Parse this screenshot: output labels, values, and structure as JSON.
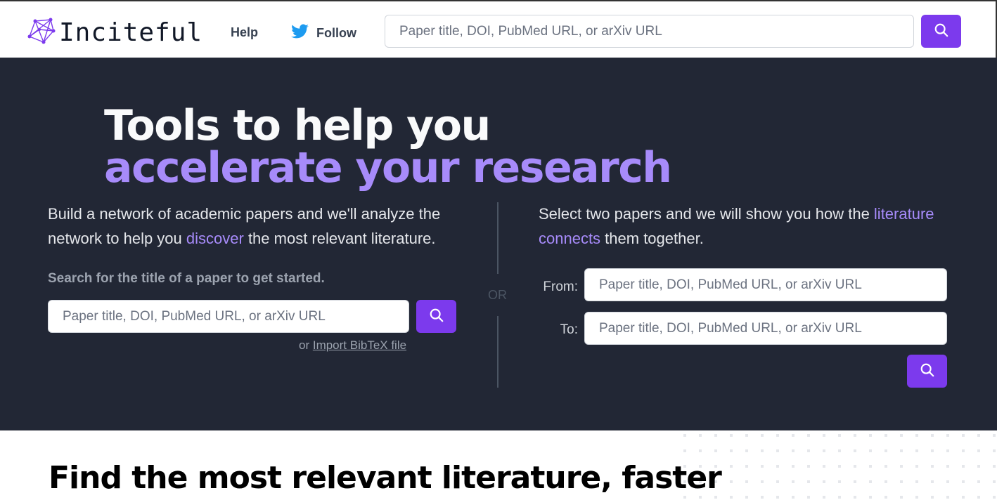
{
  "brand": {
    "name": "Inciteful"
  },
  "nav": {
    "help": "Help",
    "follow": "Follow",
    "search_placeholder": "Paper title, DOI, PubMed URL, or arXiv URL"
  },
  "hero": {
    "title_line1": "Tools to help you",
    "title_line2": "accelerate your research",
    "left": {
      "lead_part1": "Build a network of academic papers and we'll analyze the network to help you ",
      "lead_accent": "discover",
      "lead_part2": " the most relevant literature.",
      "hint": "Search for the title of a paper to get started.",
      "search_placeholder": "Paper title, DOI, PubMed URL, or arXiv URL",
      "or_text": "or ",
      "import_link": "Import BibTeX file"
    },
    "or_divider": "OR",
    "right": {
      "lead_part1": "Select two papers and we will show you how the ",
      "lead_accent": "literature connects",
      "lead_part2": " them together.",
      "from_label": "From:",
      "to_label": "To:",
      "from_placeholder": "Paper title, DOI, PubMed URL, or arXiv URL",
      "to_placeholder": "Paper title, DOI, PubMed URL, or arXiv URL"
    }
  },
  "section": {
    "heading": "Find the most relevant literature, faster"
  },
  "colors": {
    "accent": "#7c3aed",
    "accent_light": "#a78bfa",
    "hero_bg": "#222735"
  },
  "icons": {
    "logo": "network-graph-icon",
    "twitter": "twitter-bird-icon",
    "search": "magnifier-icon"
  }
}
